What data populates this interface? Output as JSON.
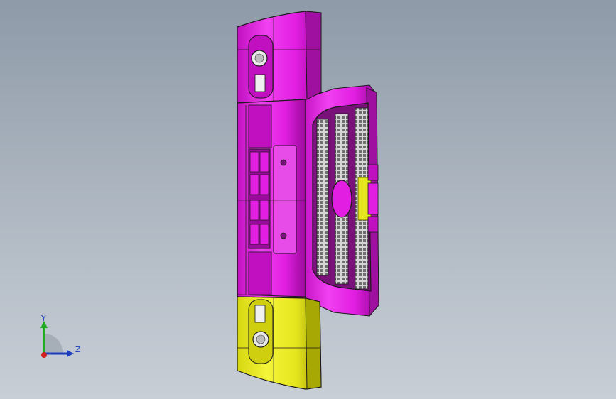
{
  "viewport": {
    "background_top": "#8e9aa8",
    "background_bottom": "#c8ced6"
  },
  "model": {
    "name": "",
    "colors": {
      "upper_body": "#e21ee2",
      "upper_dark": "#8a0a8a",
      "lower_body": "#e6e61e",
      "lower_dark": "#6f6f00",
      "edge": "#1a1a1a",
      "grille_mesh": "#b8b8b8"
    }
  },
  "triad": {
    "y_label": "Y",
    "z_label": "Z",
    "y_color": "#1fae1f",
    "z_color": "#1f3fbf",
    "x_color": "#d01f1f"
  }
}
